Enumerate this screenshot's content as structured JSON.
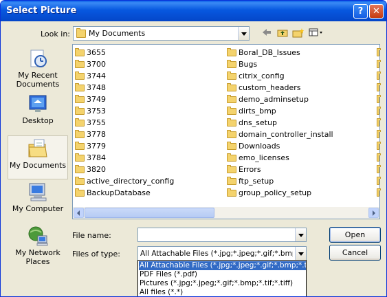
{
  "window": {
    "title": "Select Picture",
    "help_label": "?",
    "close_label": "✕"
  },
  "lookin": {
    "label": "Look in:",
    "value": "My Documents"
  },
  "places": [
    {
      "label": "My Recent Documents",
      "icon": "recent-documents-icon"
    },
    {
      "label": "Desktop",
      "icon": "desktop-icon"
    },
    {
      "label": "My Documents",
      "icon": "my-documents-icon",
      "selected": true
    },
    {
      "label": "My Computer",
      "icon": "my-computer-icon"
    },
    {
      "label": "My Network Places",
      "icon": "network-places-icon"
    }
  ],
  "files": {
    "col1": [
      "3655",
      "3700",
      "3744",
      "3748",
      "3749",
      "3753",
      "3755",
      "3778",
      "3779",
      "3784",
      "3820",
      "active_directory_config",
      "BackupDatabase"
    ],
    "col2": [
      "Boral_DB_Issues",
      "Bugs",
      "citrix_config",
      "custom_headers",
      "demo_adminsetup",
      "dirts_bmp",
      "dns_setup",
      "domain_controller_install",
      "Downloads",
      "emo_licenses",
      "Errors",
      "ftp_setup",
      "group_policy_setup"
    ]
  },
  "form": {
    "filename_label": "File name:",
    "filename_value": "",
    "filetype_label": "Files of type:",
    "filetype_value": "All Attachable Files (*.jpg;*.jpeg;*.gif;*.bmp;*.tif;*.tiff)",
    "open_label": "Open",
    "cancel_label": "Cancel"
  },
  "filetype_options": [
    "All Attachable Files (*.jpg;*.jpeg;*.gif;*.bmp;*.tif;*.tiff)",
    "PDF Files (*.pdf)",
    "Pictures (*.jpg;*.jpeg;*.gif;*.bmp;*.tif;*.tiff)",
    "All files (*.*)"
  ],
  "colors": {
    "title_bar": "#0a5fe8",
    "selection": "#316ac5",
    "window_bg": "#ece9d8"
  }
}
